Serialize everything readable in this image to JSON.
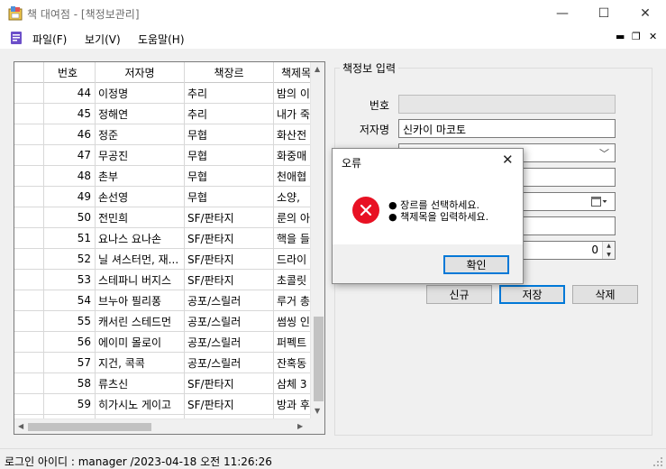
{
  "window": {
    "title": "책 대여점 - [책정보관리]",
    "controls": {
      "minimize": "—",
      "maximize": "☐",
      "close": "✕"
    }
  },
  "menu": {
    "items": [
      "파일(F)",
      "보기(V)",
      "도움말(H)"
    ],
    "mdi_controls": [
      "▬",
      "❐",
      "✕"
    ]
  },
  "grid": {
    "columns": [
      "",
      "번호",
      "저자명",
      "책장르",
      "책제목"
    ],
    "rows": [
      {
        "no": "44",
        "author": "이정명",
        "genre": "추리",
        "title": "밤의 이"
      },
      {
        "no": "45",
        "author": "정해연",
        "genre": "추리",
        "title": "내가 죽"
      },
      {
        "no": "46",
        "author": "정준",
        "genre": "무협",
        "title": "화산전"
      },
      {
        "no": "47",
        "author": "무공진",
        "genre": "무협",
        "title": "화중매"
      },
      {
        "no": "48",
        "author": "촌부",
        "genre": "무협",
        "title": "천애협"
      },
      {
        "no": "49",
        "author": "손선영",
        "genre": "무협",
        "title": "소양,"
      },
      {
        "no": "50",
        "author": "전민희",
        "genre": "SF/판타지",
        "title": "룬의 아"
      },
      {
        "no": "51",
        "author": "요나스 요나손",
        "genre": "SF/판타지",
        "title": "핵을 들"
      },
      {
        "no": "52",
        "author": "닐 셔스터먼, 재...",
        "genre": "SF/판타지",
        "title": "드라이"
      },
      {
        "no": "53",
        "author": "스테파니 버지스",
        "genre": "SF/판타지",
        "title": "초콜릿"
      },
      {
        "no": "54",
        "author": "브누아 필리퐁",
        "genre": "공포/스릴러",
        "title": "루거 총"
      },
      {
        "no": "55",
        "author": "캐서린 스테드먼",
        "genre": "공포/스릴러",
        "title": "썸씽 인"
      },
      {
        "no": "56",
        "author": "에이미 몰로이",
        "genre": "공포/스릴러",
        "title": "퍼펙트"
      },
      {
        "no": "57",
        "author": "지건, 콕콕",
        "genre": "공포/스릴러",
        "title": "잔혹동"
      },
      {
        "no": "58",
        "author": "류츠신",
        "genre": "SF/판타지",
        "title": "삼체 3"
      },
      {
        "no": "59",
        "author": "히가시노 게이고",
        "genre": "SF/판타지",
        "title": "방과 후"
      },
      {
        "no": "",
        "author": "",
        "genre": "",
        "title": ""
      }
    ]
  },
  "form": {
    "group_title": "책정보 입력",
    "labels": {
      "number": "번호",
      "author": "저자명"
    },
    "values": {
      "number": "",
      "author": "신카이 마코토",
      "spin": "0"
    },
    "icons": {
      "combo": "chevron-down-icon",
      "date": "calendar-icon",
      "spin": "spin-arrows-icon"
    },
    "buttons": {
      "new": "신규",
      "save": "저장",
      "delete": "삭제"
    }
  },
  "dialog": {
    "title": "오류",
    "close": "✕",
    "messages": [
      "● 장르를 선택하세요.",
      "● 책제목을 입력하세요."
    ],
    "ok": "확인",
    "icon_color": "#e81123"
  },
  "status": {
    "text": "로그인 아이디 :  manager  /2023-04-18 오전 11:26:26"
  }
}
